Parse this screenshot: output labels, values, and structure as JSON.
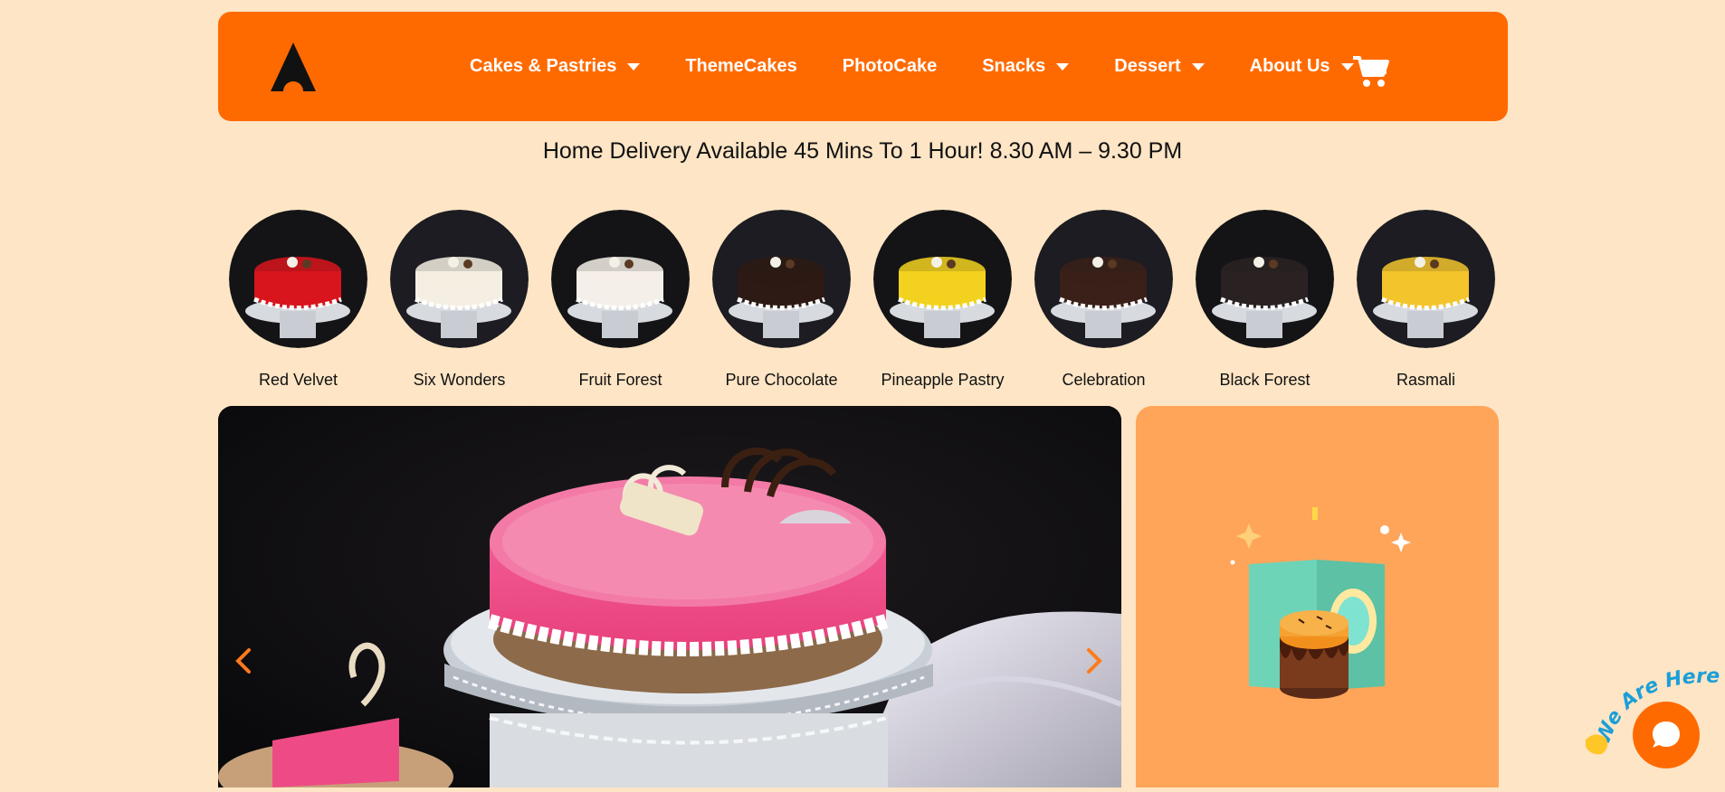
{
  "brand": {
    "logo_name": "brand-logo"
  },
  "nav": {
    "items": [
      {
        "label": "Cakes & Pastries",
        "has_dropdown": true
      },
      {
        "label": "ThemeCakes",
        "has_dropdown": false
      },
      {
        "label": "PhotoCake",
        "has_dropdown": false
      },
      {
        "label": "Snacks",
        "has_dropdown": true
      },
      {
        "label": "Dessert",
        "has_dropdown": true
      },
      {
        "label": "About Us",
        "has_dropdown": true
      }
    ],
    "cart_icon": "cart-icon"
  },
  "delivery_banner": "Home Delivery  Available 45 Mins To 1 Hour! 8.30 AM – 9.30 PM",
  "categories": [
    {
      "label": "Red Velvet",
      "frosting": "#d8141c"
    },
    {
      "label": "Six Wonders",
      "frosting": "#f4efe2"
    },
    {
      "label": "Fruit Forest",
      "frosting": "#f4efe8"
    },
    {
      "label": "Pure Chocolate",
      "frosting": "#2d1a14"
    },
    {
      "label": "Pineapple Pastry",
      "frosting": "#f2d21e"
    },
    {
      "label": "Celebration",
      "frosting": "#3a2018"
    },
    {
      "label": "Black Forest",
      "frosting": "#2a2222"
    },
    {
      "label": "Rasmali",
      "frosting": "#f3c42b"
    }
  ],
  "colors": {
    "page_bg": "#fde5c5",
    "brand_orange": "#ff6a00",
    "promo_bg": "#fea55a",
    "slider_bg": "#0e0e10"
  },
  "slider": {
    "prev_icon": "chevron-left-icon",
    "next_icon": "chevron-right-icon"
  },
  "chat": {
    "badge_text": "We Are Here!",
    "icon": "chat-bubble-icon"
  }
}
